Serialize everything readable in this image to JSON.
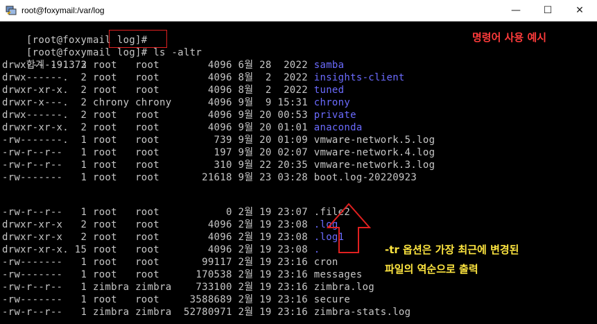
{
  "window": {
    "title": "root@foxymail:/var/log",
    "minimize_glyph": "—",
    "maximize_glyph": "☐",
    "close_glyph": "✕"
  },
  "terminal": {
    "prompt_line1": "[root@foxymail log]#",
    "prompt_line2": "[root@foxymail log]#",
    "command": " ls -altr",
    "total": "합계 191372",
    "rows_top": [
      {
        "perm": "drwx------.",
        "links": " 3",
        "owner": "root  ",
        "group": "root  ",
        "size": "     4096",
        "month": "6월",
        "day": "28",
        "time": " 2022",
        "name": "samba",
        "dir": true
      },
      {
        "perm": "drwx------.",
        "links": " 2",
        "owner": "root  ",
        "group": "root  ",
        "size": "     4096",
        "month": "8월",
        "day": " 2",
        "time": " 2022",
        "name": "insights-client",
        "dir": true
      },
      {
        "perm": "drwxr-xr-x.",
        "links": " 2",
        "owner": "root  ",
        "group": "root  ",
        "size": "     4096",
        "month": "8월",
        "day": " 2",
        "time": " 2022",
        "name": "tuned",
        "dir": true
      },
      {
        "perm": "drwxr-x---.",
        "links": " 2",
        "owner": "chrony",
        "group": "chrony",
        "size": "     4096",
        "month": "9월",
        "day": " 9",
        "time": "15:31",
        "name": "chrony",
        "dir": true
      },
      {
        "perm": "drwx------.",
        "links": " 2",
        "owner": "root  ",
        "group": "root  ",
        "size": "     4096",
        "month": "9월",
        "day": "20",
        "time": "00:53",
        "name": "private",
        "dir": true
      },
      {
        "perm": "drwxr-xr-x.",
        "links": " 2",
        "owner": "root  ",
        "group": "root  ",
        "size": "     4096",
        "month": "9월",
        "day": "20",
        "time": "01:01",
        "name": "anaconda",
        "dir": true
      },
      {
        "perm": "-rw-------.",
        "links": " 1",
        "owner": "root  ",
        "group": "root  ",
        "size": "      739",
        "month": "9월",
        "day": "20",
        "time": "01:09",
        "name": "vmware-network.5.log",
        "dir": false
      },
      {
        "perm": "-rw-r--r-- ",
        "links": " 1",
        "owner": "root  ",
        "group": "root  ",
        "size": "      197",
        "month": "9월",
        "day": "20",
        "time": "02:07",
        "name": "vmware-network.4.log",
        "dir": false
      },
      {
        "perm": "-rw-r--r-- ",
        "links": " 1",
        "owner": "root  ",
        "group": "root  ",
        "size": "      310",
        "month": "9월",
        "day": "22",
        "time": "20:35",
        "name": "vmware-network.3.log",
        "dir": false
      },
      {
        "perm": "-rw------- ",
        "links": " 1",
        "owner": "root  ",
        "group": "root  ",
        "size": "    21618",
        "month": "9월",
        "day": "23",
        "time": "03:28",
        "name": "boot.log-20220923",
        "dir": false
      }
    ],
    "rows_bottom": [
      {
        "perm": "-rw-r--r-- ",
        "links": " 1",
        "owner": "root  ",
        "group": "root  ",
        "size": "        0",
        "month": "2월",
        "day": "19",
        "time": "23:07",
        "name": ".file2",
        "dir": false
      },
      {
        "perm": "drwxr-xr-x ",
        "links": " 2",
        "owner": "root  ",
        "group": "root  ",
        "size": "     4096",
        "month": "2월",
        "day": "19",
        "time": "23:08",
        "name": ".log",
        "dir": true
      },
      {
        "perm": "drwxr-xr-x ",
        "links": " 2",
        "owner": "root  ",
        "group": "root  ",
        "size": "     4096",
        "month": "2월",
        "day": "19",
        "time": "23:08",
        "name": ".log1",
        "dir": true
      },
      {
        "perm": "drwxr-xr-x.",
        "links": "15",
        "owner": "root  ",
        "group": "root  ",
        "size": "     4096",
        "month": "2월",
        "day": "19",
        "time": "23:08",
        "name": ".",
        "dir": true
      },
      {
        "perm": "-rw------- ",
        "links": " 1",
        "owner": "root  ",
        "group": "root  ",
        "size": "    99117",
        "month": "2월",
        "day": "19",
        "time": "23:16",
        "name": "cron",
        "dir": false
      },
      {
        "perm": "-rw------- ",
        "links": " 1",
        "owner": "root  ",
        "group": "root  ",
        "size": "   170538",
        "month": "2월",
        "day": "19",
        "time": "23:16",
        "name": "messages",
        "dir": false
      },
      {
        "perm": "-rw-r--r-- ",
        "links": " 1",
        "owner": "zimbra",
        "group": "zimbra",
        "size": "   733100",
        "month": "2월",
        "day": "19",
        "time": "23:16",
        "name": "zimbra.log",
        "dir": false
      },
      {
        "perm": "-rw------- ",
        "links": " 1",
        "owner": "root  ",
        "group": "root  ",
        "size": "  3588689",
        "month": "2월",
        "day": "19",
        "time": "23:16",
        "name": "secure",
        "dir": false
      },
      {
        "perm": "-rw-r--r-- ",
        "links": " 1",
        "owner": "zimbra",
        "group": "zimbra",
        "size": " 52780971",
        "month": "2월",
        "day": "19",
        "time": "23:16",
        "name": "zimbra-stats.log",
        "dir": false
      }
    ]
  },
  "annotations": {
    "example_label": "명령어 사용 예시",
    "note_line1": "-tr 옵션은 가장 최근에 변경된",
    "note_line2": "파일의 역순으로 출력"
  },
  "colors": {
    "background": "#000000",
    "text": "#c7c7c7",
    "directory": "#6b6bff",
    "annotation_red": "#ff3b3b",
    "annotation_yellow": "#ffe640"
  }
}
